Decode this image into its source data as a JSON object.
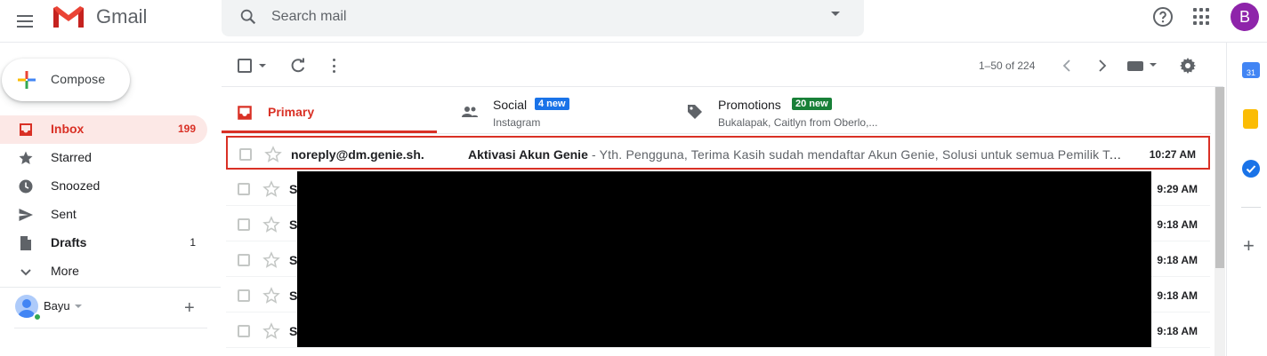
{
  "header": {
    "app_name": "Gmail",
    "search_placeholder": "Search mail",
    "avatar_letter": "B"
  },
  "sidebar": {
    "compose_label": "Compose",
    "items": [
      {
        "label": "Inbox",
        "count": "199",
        "icon": "inbox-icon"
      },
      {
        "label": "Starred",
        "count": "",
        "icon": "star-icon"
      },
      {
        "label": "Snoozed",
        "count": "",
        "icon": "clock-icon"
      },
      {
        "label": "Sent",
        "count": "",
        "icon": "send-icon"
      },
      {
        "label": "Drafts",
        "count": "1",
        "icon": "draft-icon"
      },
      {
        "label": "More",
        "count": "",
        "icon": "chevron-down-icon"
      }
    ],
    "hangouts_user": "Bayu"
  },
  "toolbar": {
    "pagination": "1–50 of 224"
  },
  "tabs": [
    {
      "label": "Primary",
      "badge": "",
      "sub": ""
    },
    {
      "label": "Social",
      "badge": "4 new",
      "sub": "Instagram"
    },
    {
      "label": "Promotions",
      "badge": "20 new",
      "sub": "Bukalapak, Caitlyn from Oberlo,..."
    }
  ],
  "emails": [
    {
      "sender": "noreply@dm.genie.sh.",
      "subject": "Aktivasi Akun Genie",
      "snippet": " - Yth. Pengguna, Terima Kasih sudah mendaftar Akun Genie, Solusi untuk semua Pemilik To…",
      "time": "10:27 AM"
    },
    {
      "sender": "S",
      "subject": "",
      "snippet": "",
      "time": "9:29 AM"
    },
    {
      "sender": "S",
      "subject": "",
      "snippet": "",
      "time": "9:18 AM"
    },
    {
      "sender": "S",
      "subject": "",
      "snippet": "",
      "time": "9:18 AM"
    },
    {
      "sender": "S",
      "subject": "",
      "snippet": "",
      "time": "9:18 AM"
    },
    {
      "sender": "S",
      "subject": "",
      "snippet": "",
      "time": "9:18 AM"
    }
  ],
  "side_panel": {
    "calendar_date": "31"
  },
  "colors": {
    "accent_red": "#d93025",
    "social_badge": "#1a73e8",
    "promotions_badge": "#188038",
    "avatar_bg": "#8e24aa"
  }
}
